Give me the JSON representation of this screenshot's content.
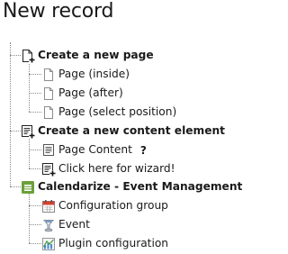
{
  "page": {
    "title": "New record"
  },
  "tree": {
    "groups": [
      {
        "label": "Create a new page",
        "icon": "new-page-icon",
        "items": [
          {
            "label": "Page (inside)",
            "icon": "page-icon"
          },
          {
            "label": "Page (after)",
            "icon": "page-icon"
          },
          {
            "label": "Page (select position)",
            "icon": "page-icon"
          }
        ]
      },
      {
        "label": "Create a new content element",
        "icon": "new-content-element-icon",
        "items": [
          {
            "label": "Page Content",
            "icon": "content-element-icon",
            "help": "?"
          },
          {
            "label": "Click here for wizard!",
            "icon": "content-wizard-icon"
          }
        ]
      },
      {
        "label": "Calendarize - Event Management",
        "icon": "calendarize-extension-icon",
        "items": [
          {
            "label": "Configuration group",
            "icon": "calendar-icon"
          },
          {
            "label": "Event",
            "icon": "event-icon"
          },
          {
            "label": "Plugin configuration",
            "icon": "plugin-chart-icon"
          }
        ]
      }
    ]
  },
  "colors": {
    "calendarize_green": "#6aa03a",
    "calendar_red": "#d64032",
    "tree_line": "#8a8a8a"
  }
}
